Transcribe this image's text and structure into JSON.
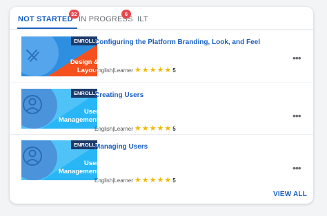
{
  "tabs": [
    {
      "label": "NOT STARTED",
      "badge": "32"
    },
    {
      "label": "IN PROGRESS",
      "badge": "6"
    },
    {
      "label": "ILT"
    }
  ],
  "courses": [
    {
      "title": "Configuring the Platform Branding, Look, and Feel",
      "thumb_line1": "Design &",
      "thumb_line2": "Layout",
      "enrolled": "ENROLLED",
      "language": "English",
      "type": "Learner",
      "rating": "5",
      "thumb_icon": "pencil-ruler-icon"
    },
    {
      "title": "Creating Users",
      "thumb_line1": "User",
      "thumb_line2": "Management",
      "enrolled": "ENROLLED",
      "language": "English",
      "type": "Learner",
      "rating": "5",
      "thumb_icon": "user-circle-icon"
    },
    {
      "title": "Managing Users",
      "thumb_line1": "User",
      "thumb_line2": "Management",
      "enrolled": "ENROLLED",
      "language": "English",
      "type": "Learner",
      "rating": "5",
      "thumb_icon": "user-circle-icon"
    }
  ],
  "meta_separator": "|",
  "more_label": "•••",
  "view_all": "VIEW ALL",
  "colors": {
    "accent": "#1a5fc0",
    "badge": "#e5484d",
    "star": "#f2b705",
    "enrolled_bg": "#1c3b6b"
  }
}
